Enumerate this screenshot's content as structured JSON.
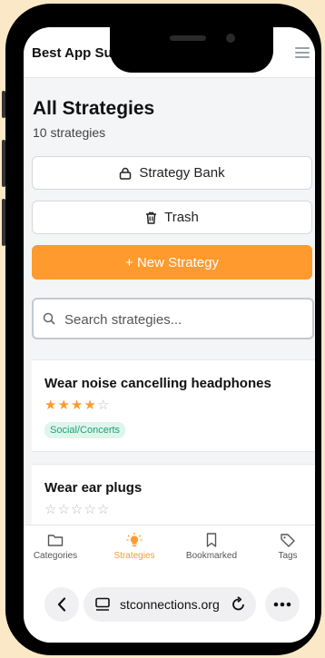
{
  "header": {
    "title": "Best App Suite",
    "menu_icon": "hamburger-icon"
  },
  "page": {
    "title": "All Strategies",
    "count": "10 strategies"
  },
  "actions": {
    "strategy_bank": "Strategy Bank",
    "trash": "Trash",
    "new_strategy": "+ New Strategy"
  },
  "search": {
    "placeholder": "Search strategies...",
    "value": ""
  },
  "strategies": [
    {
      "title": "Wear noise cancelling headphones",
      "rating": 4,
      "max_rating": 5,
      "tag": "Social/Concerts"
    },
    {
      "title": "Wear ear plugs",
      "rating": 0,
      "max_rating": 5,
      "tag": ""
    }
  ],
  "bottom_nav": [
    {
      "label": "Categories",
      "icon": "folder-icon",
      "active": false
    },
    {
      "label": "Strategies",
      "icon": "lightbulb-icon",
      "active": true
    },
    {
      "label": "Bookmarked",
      "icon": "bookmark-icon",
      "active": false
    },
    {
      "label": "Tags",
      "icon": "tag-icon",
      "active": false
    }
  ],
  "browser": {
    "url": "stconnections.org"
  },
  "colors": {
    "accent": "#ff9a2e",
    "tag_bg": "#dff5ec",
    "tag_text": "#1aa37a"
  }
}
